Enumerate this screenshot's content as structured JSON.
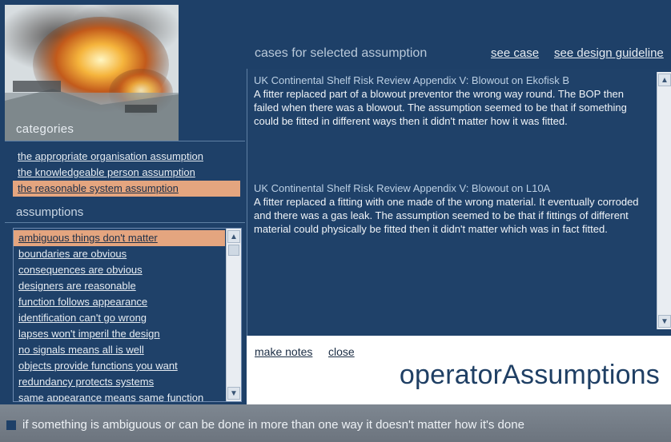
{
  "photo": {
    "label": "categories"
  },
  "categories": [
    {
      "label": "the appropriate organisation assumption",
      "selected": false
    },
    {
      "label": "the knowledgeable person assumption",
      "selected": false
    },
    {
      "label": "the reasonable system assumption",
      "selected": true
    }
  ],
  "assumptions_heading": "assumptions",
  "assumptions": [
    {
      "label": "ambiguous things don't matter",
      "selected": true
    },
    {
      "label": "boundaries are obvious",
      "selected": false
    },
    {
      "label": "consequences are obvious",
      "selected": false
    },
    {
      "label": "designers are reasonable",
      "selected": false
    },
    {
      "label": "function follows appearance",
      "selected": false
    },
    {
      "label": "identification can't go wrong",
      "selected": false
    },
    {
      "label": "lapses won't imperil the design",
      "selected": false
    },
    {
      "label": "no signals means all is well",
      "selected": false
    },
    {
      "label": "objects provide functions you want",
      "selected": false
    },
    {
      "label": "redundancy protects systems",
      "selected": false
    },
    {
      "label": "same appearance means same function",
      "selected": false
    }
  ],
  "cases_header": "cases for selected assumption",
  "header_links": {
    "see_case": "see case",
    "see_guidelines": "see design guideline"
  },
  "cases": [
    {
      "title": "UK Continental Shelf Risk Review Appendix V: Blowout on Ekofisk B",
      "body": "A fitter replaced part of a blowout preventor the wrong way round. The BOP then failed when there was a blowout. The assumption seemed to be that if something could be fitted in different ways then it didn't matter how it was fitted."
    },
    {
      "title": "UK Continental Shelf Risk Review Appendix V: Blowout on L10A",
      "body": "A fitter replaced a fitting with one made of the wrong material. It eventually corroded and there was a gas leak. The assumption seemed to be that if fittings of different material could physically be fitted then it didn't matter which was in fact fitted."
    }
  ],
  "notes": {
    "make_notes": "make notes",
    "close": "close",
    "brand": "operatorAssumptions"
  },
  "status_text": "if something is ambiguous or can be done in more than one way it doesn't matter how it's done",
  "colors": {
    "background": "#1e4068",
    "selection": "#e4a57f",
    "status_bar": "#757e88"
  },
  "icons": {
    "scroll_up": "up-arrow-icon",
    "scroll_down": "down-arrow-icon"
  }
}
